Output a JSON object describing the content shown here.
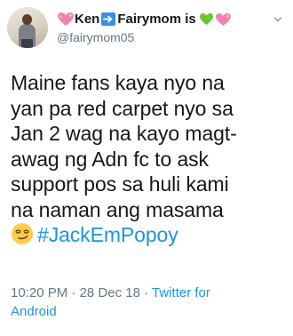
{
  "tweet": {
    "display_name_pre": "Ken",
    "display_name_mid": "Fairymom is",
    "handle": "@fairymom05",
    "emoji": {
      "sparkle_heart": "sparkling-heart-icon",
      "arrow": "right-arrow-icon",
      "green_heart": "green-heart-icon",
      "smirk": "smirking-face-icon"
    },
    "text_lines": [
      "Maine fans kaya nyo na",
      "yan pa red carpet nyo sa",
      "Jan 2 wag na kayo magt-",
      "awag ng Adn fc to ask",
      "support pos sa huli kami",
      "na naman ang masama"
    ],
    "hashtag": "#JackEmPopoy",
    "time": "10:20 PM",
    "separator": "·",
    "date": "28 Dec 18",
    "source_line1": "Twitter for",
    "source_line2": "Android",
    "colors": {
      "link": "#1b95e0",
      "text": "#14171a",
      "muted": "#657786",
      "arrow_bg": "#3b8ee0"
    }
  }
}
